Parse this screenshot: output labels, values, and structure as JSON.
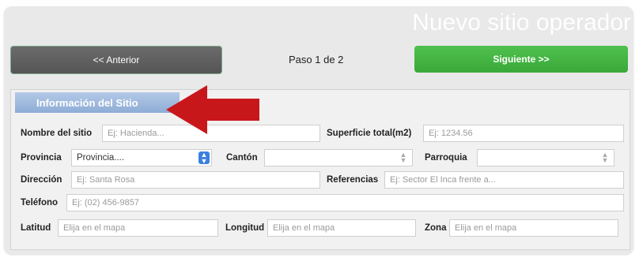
{
  "header": {
    "title": "Nuevo sitio operador",
    "prev_label": "<< Anterior",
    "step_label": "Paso 1 de 2",
    "next_label": "Siguiente >>"
  },
  "section": {
    "title": "Información del Sitio"
  },
  "form": {
    "nombre": {
      "label": "Nombre del sitio",
      "placeholder": "Ej: Hacienda..."
    },
    "superficie": {
      "label": "Superficie total(m2)",
      "placeholder": "Ej: 1234.56"
    },
    "provincia": {
      "label": "Provincia",
      "value": "Provincia...."
    },
    "canton": {
      "label": "Cantón",
      "value": ""
    },
    "parroquia": {
      "label": "Parroquia",
      "value": ""
    },
    "direccion": {
      "label": "Dirección",
      "placeholder": "Ej: Santa Rosa"
    },
    "referencias": {
      "label": "Referencias",
      "placeholder": "Ej: Sector El Inca frente a..."
    },
    "telefono": {
      "label": "Teléfono",
      "placeholder": "Ej: (02) 456-9857"
    },
    "latitud": {
      "label": "Latitud",
      "placeholder": "Elija en el mapa"
    },
    "longitud": {
      "label": "Longitud",
      "placeholder": "Elija en el mapa"
    },
    "zona": {
      "label": "Zona",
      "placeholder": "Elija en el mapa"
    }
  },
  "colors": {
    "accent_green": "#3aa83a",
    "prev_gray": "#5a5a5a",
    "section_blue": "#9bb6dd",
    "annotation_red": "#c8171b"
  },
  "icons": {
    "annotation": "red-left-arrow-icon",
    "select": "chevron-updown-icon"
  }
}
